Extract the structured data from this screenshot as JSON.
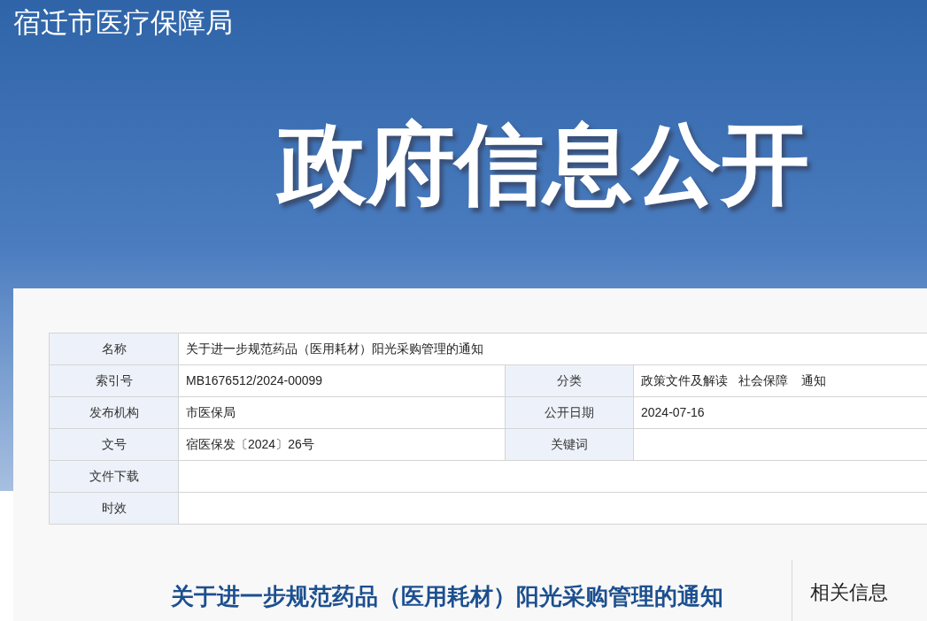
{
  "site_title": "宿迁市医疗保障局",
  "banner_title": "政府信息公开",
  "info_table": [
    {
      "cells": [
        {
          "label": "名称",
          "value": "关于进一步规范药品（医用耗材）阳光采购管理的通知"
        }
      ]
    },
    {
      "cells": [
        {
          "label": "索引号",
          "value": "MB1676512/2024-00099"
        },
        {
          "label": "分类",
          "value": "政策文件及解读   社会保障    通知"
        }
      ]
    },
    {
      "cells": [
        {
          "label": "发布机构",
          "value": "市医保局"
        },
        {
          "label": "公开日期",
          "value": "2024-07-16"
        }
      ]
    },
    {
      "cells": [
        {
          "label": "文号",
          "value": "宿医保发〔2024〕26号"
        },
        {
          "label": "关键词"
        }
      ]
    },
    {
      "cells": [
        {
          "label": "文件下载"
        }
      ]
    },
    {
      "cells": [
        {
          "label": "时效"
        }
      ]
    }
  ],
  "article_title": "关于进一步规范药品（医用耗材）阳光采购管理的通知",
  "sidebar": {
    "heading": "相关信息"
  }
}
